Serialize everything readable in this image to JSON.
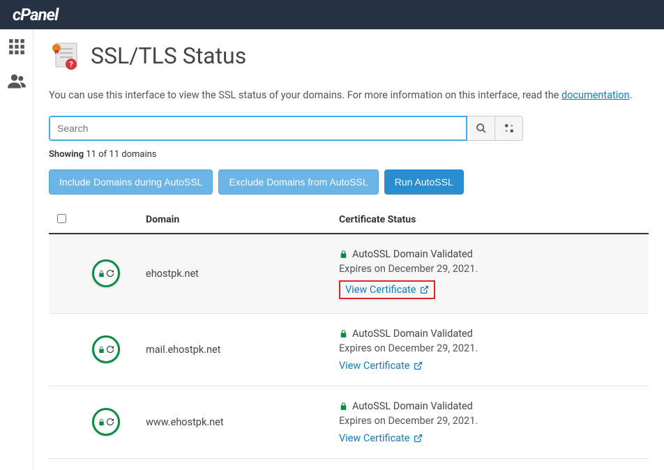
{
  "logo": "cPanel",
  "pageTitle": "SSL/TLS Status",
  "intro": {
    "text1": "You can use this interface to view the SSL status of your domains. For more information on this interface, read the ",
    "docLink": "documentation",
    "text2": "."
  },
  "search": {
    "placeholder": "Search"
  },
  "showing": {
    "prefix": "Showing ",
    "count": "11 of 11 domains"
  },
  "buttons": {
    "include": "Include Domains during AutoSSL",
    "exclude": "Exclude Domains from AutoSSL",
    "run": "Run AutoSSL"
  },
  "headers": {
    "domain": "Domain",
    "certStatus": "Certificate Status"
  },
  "rows": [
    {
      "domain": "ehostpk.net",
      "status": "AutoSSL Domain Validated",
      "expires": "Expires on December 29, 2021.",
      "viewLabel": "View Certificate",
      "highlighted": true
    },
    {
      "domain": "mail.ehostpk.net",
      "status": "AutoSSL Domain Validated",
      "expires": "Expires on December 29, 2021.",
      "viewLabel": "View Certificate",
      "highlighted": false
    },
    {
      "domain": "www.ehostpk.net",
      "status": "AutoSSL Domain Validated",
      "expires": "Expires on December 29, 2021.",
      "viewLabel": "View Certificate",
      "highlighted": false
    }
  ]
}
